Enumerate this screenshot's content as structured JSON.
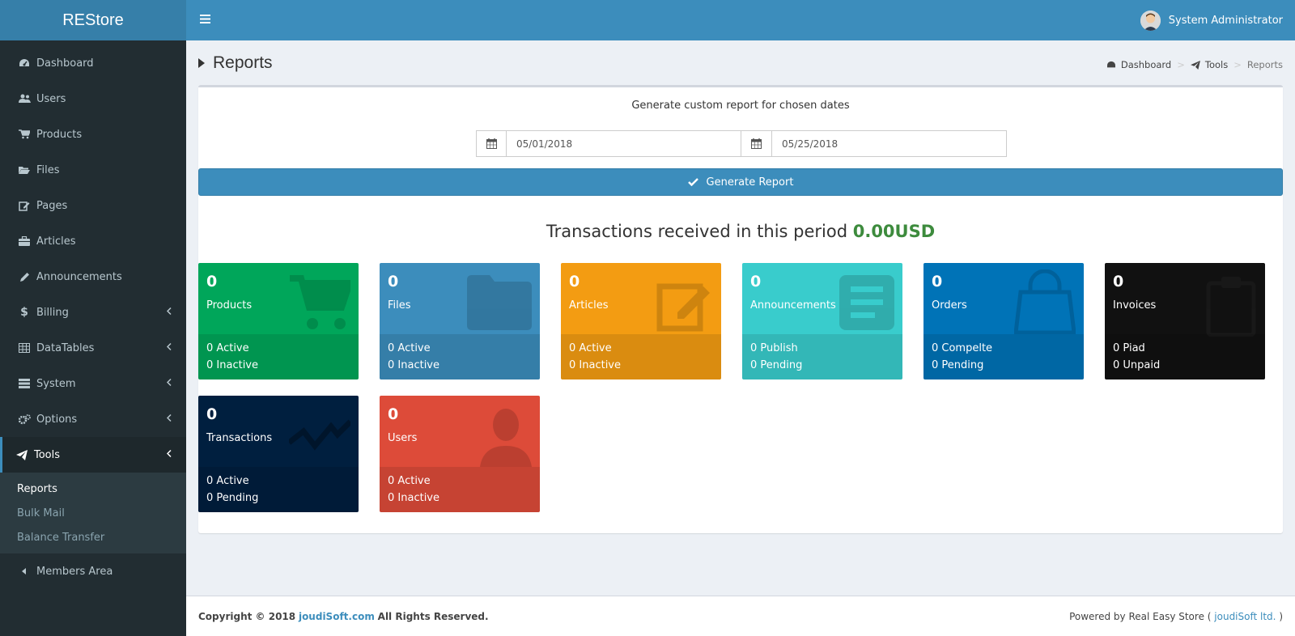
{
  "app": {
    "logo": "REStore"
  },
  "header": {
    "user_name": "System Administrator"
  },
  "sidebar": {
    "items": [
      {
        "label": "Dashboard",
        "icon": "dashboard-icon"
      },
      {
        "label": "Users",
        "icon": "users-icon"
      },
      {
        "label": "Products",
        "icon": "cart-icon"
      },
      {
        "label": "Files",
        "icon": "folder-icon"
      },
      {
        "label": "Pages",
        "icon": "edit-icon"
      },
      {
        "label": "Articles",
        "icon": "briefcase-icon"
      },
      {
        "label": "Announcements",
        "icon": "pencil-icon"
      },
      {
        "label": "Billing",
        "icon": "dollar-icon"
      },
      {
        "label": "DataTables",
        "icon": "table-icon"
      },
      {
        "label": "System",
        "icon": "server-icon"
      },
      {
        "label": "Options",
        "icon": "cogs-icon"
      },
      {
        "label": "Tools",
        "icon": "paper-plane-icon"
      }
    ],
    "submenu": [
      "Reports",
      "Bulk Mail",
      "Balance Transfer"
    ],
    "members": "Members Area"
  },
  "page": {
    "title": "Reports",
    "breadcrumb": [
      "Dashboard",
      "Tools",
      "Reports"
    ]
  },
  "report": {
    "heading": "Generate custom report for chosen dates",
    "start_date": "05/01/2018",
    "end_date": "05/25/2018",
    "button": "Generate Report",
    "transactions_label": "Transactions received in this period",
    "transactions_amount": "0.00USD"
  },
  "tiles": [
    {
      "count": "0",
      "label": "Products",
      "line1": "0 Active",
      "line2": "0 Inactive",
      "color": "#00a65a",
      "icon": "cart-icon"
    },
    {
      "count": "0",
      "label": "Files",
      "line1": "0 Active",
      "line2": "0 Inactive",
      "color": "#3c8dbc",
      "icon": "folder-icon"
    },
    {
      "count": "0",
      "label": "Articles",
      "line1": "0 Active",
      "line2": "0 Inactive",
      "color": "#f39c12",
      "icon": "edit-icon"
    },
    {
      "count": "0",
      "label": "Announcements",
      "line1": "0 Publish",
      "line2": "0 Pending",
      "color": "#39cccc",
      "icon": "list-alt-icon"
    },
    {
      "count": "0",
      "label": "Orders",
      "line1": "0 Compelte",
      "line2": "0 Pending",
      "color": "#0073b7",
      "icon": "shopping-bag-icon"
    },
    {
      "count": "0",
      "label": "Invoices",
      "line1": "0 Piad",
      "line2": "0 Unpaid",
      "color": "#111111",
      "icon": "clipboard-icon"
    },
    {
      "count": "0",
      "label": "Transactions",
      "line1": "0 Active",
      "line2": "0 Pending",
      "color": "#001f3f",
      "icon": "line-chart-icon"
    },
    {
      "count": "0",
      "label": "Users",
      "line1": "0 Active",
      "line2": "0 Inactive",
      "color": "#dd4b39",
      "icon": "user-icon"
    }
  ],
  "footer": {
    "copyright_prefix": "Copyright © 2018",
    "company_link": "joudiSoft.com",
    "rights": "All Rights Reserved.",
    "powered_prefix": "Powered by Real Easy Store (",
    "powered_link": "joudiSoft ltd.",
    "powered_suffix": ")"
  }
}
